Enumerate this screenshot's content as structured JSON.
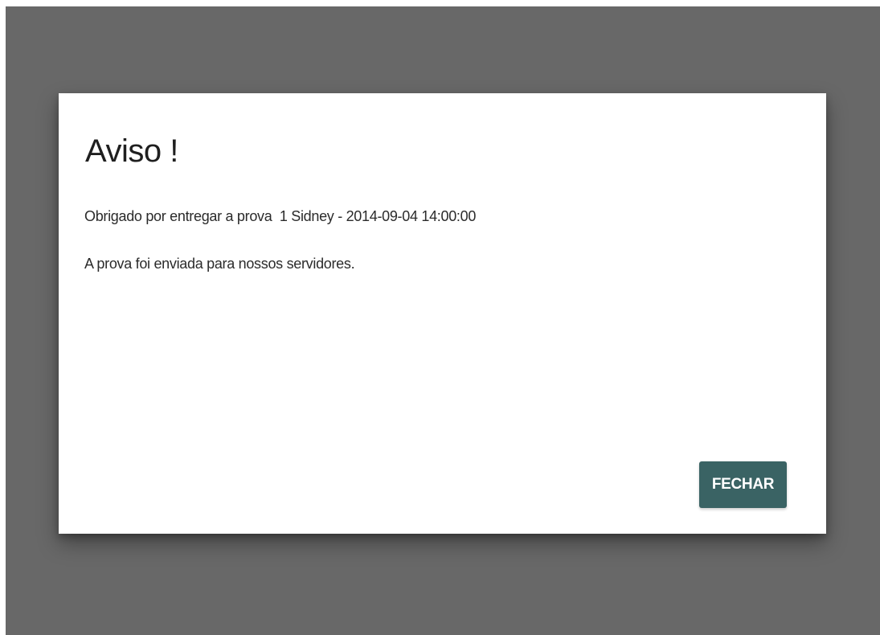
{
  "dialog": {
    "title": "Aviso !",
    "message_line1": "Obrigado por entregar a prova  1 Sidney - 2014-09-04 14:00:00",
    "message_line2": "A prova foi enviada para nossos servidores.",
    "close_label": "FECHAR"
  },
  "colors": {
    "overlay": "#686868",
    "dialog_background": "#ffffff",
    "button_background": "#3a6364",
    "button_text": "#ffffff"
  }
}
